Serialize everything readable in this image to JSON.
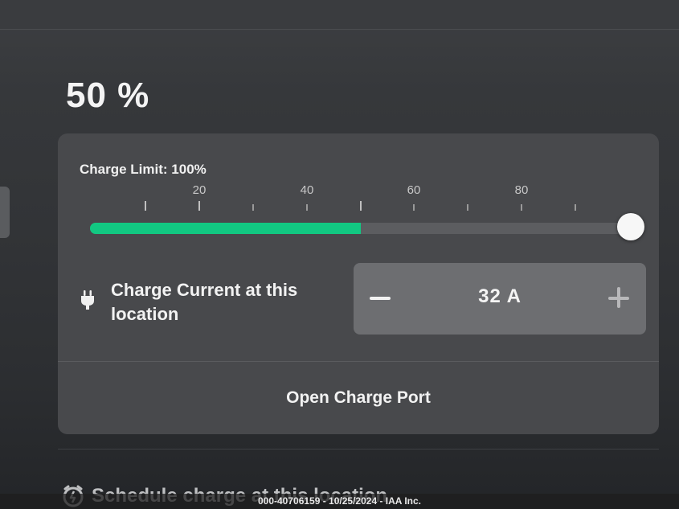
{
  "battery": {
    "percent_label": "50 %",
    "level_fraction": 0.5
  },
  "charge_limit": {
    "label": "Charge Limit: 100%",
    "value_percent": 100,
    "tick_labels": [
      "20",
      "40",
      "60",
      "80"
    ],
    "fill_color": "#12c882"
  },
  "charge_current": {
    "label": "Charge Current at this location",
    "value": "32  A",
    "icon": "plug-icon",
    "decrement_icon": "minus-icon",
    "increment_icon": "plus-icon"
  },
  "open_charge_port": {
    "label": "Open Charge Port"
  },
  "schedule": {
    "label": "Schedule charge at this location",
    "icon": "clock-icon"
  },
  "watermark": {
    "text": "000-40706159 - 10/25/2024 - IAA Inc."
  }
}
